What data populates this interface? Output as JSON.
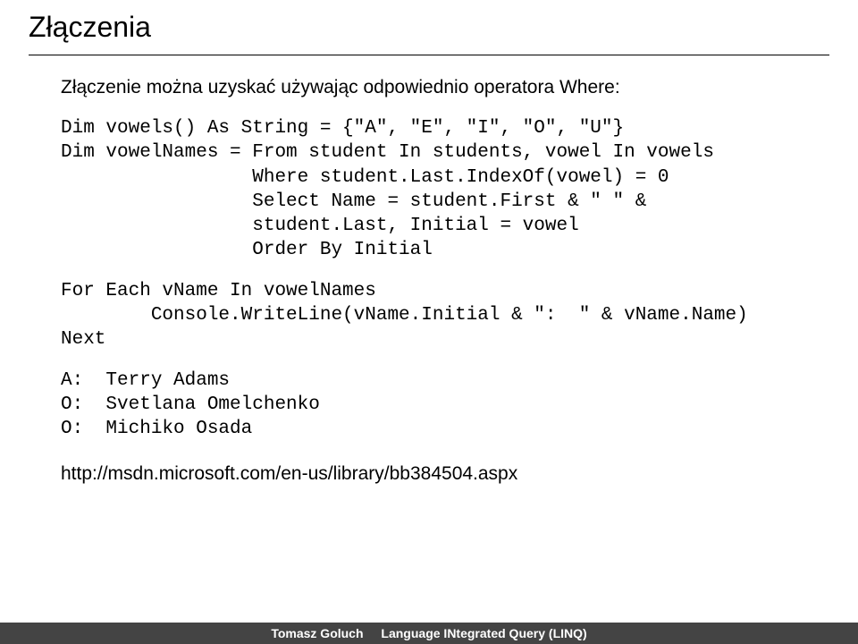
{
  "title": "Złączenia",
  "subtitle": "Złączenie można uzyskać używając odpowiednio operatora Where:",
  "code1": "Dim vowels() As String = {\"A\", \"E\", \"I\", \"O\", \"U\"}\nDim vowelNames = From student In students, vowel In vowels\n                 Where student.Last.IndexOf(vowel) = 0\n                 Select Name = student.First & \" \" &\n                 student.Last, Initial = vowel\n                 Order By Initial",
  "code2": "For Each vName In vowelNames\n        Console.WriteLine(vName.Initial & \":  \" & vName.Name)\nNext",
  "code3": "A:  Terry Adams\nO:  Svetlana Omelchenko\nO:  Michiko Osada",
  "link": "http://msdn.microsoft.com/en-us/library/bb384504.aspx",
  "footer": {
    "author": "Tomasz Goluch",
    "topic": "Language INtegrated Query (LINQ)"
  }
}
